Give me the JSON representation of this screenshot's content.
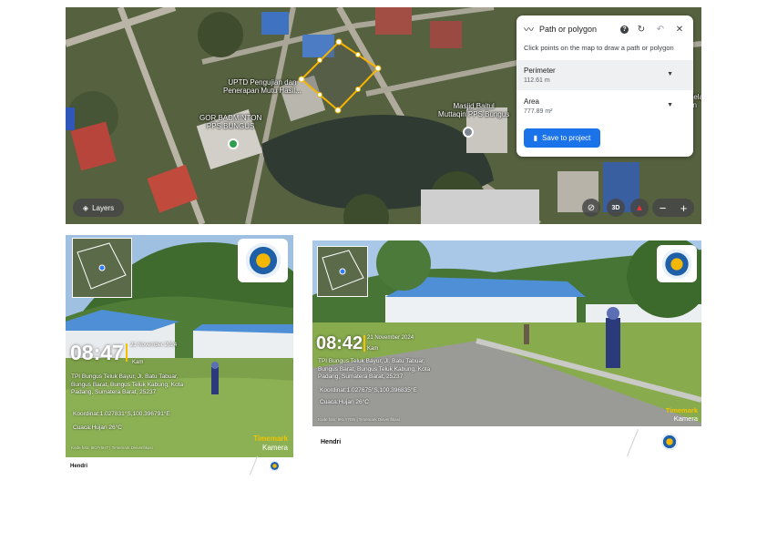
{
  "map": {
    "labels": {
      "uptd": "UPTD Pengujian dan\nPenerapan Mutu Hasil...",
      "gor": "GOR BADMINTON\nPPS BUNGUS",
      "masjid": "Masjid Baitul\nMuttaqin PPS Bungus",
      "edge": "Pelat\nan"
    },
    "layers_label": "Layers",
    "controls": {
      "compass_off_icon": "location-off-icon",
      "three_d_label": "3D",
      "zoom_out": "−",
      "zoom_in": "+"
    },
    "measure_panel": {
      "title": "Path or polygon",
      "hint": "Click points on the map to draw a path or polygon",
      "perimeter_label": "Perimeter",
      "perimeter_value": "112.61 m",
      "area_label": "Area",
      "area_value": "777.89 m²",
      "save_label": "Save to project"
    }
  },
  "photo_left": {
    "time": "08:47",
    "date": "21 November 2024",
    "day": "Kam",
    "address": "TPI Bungus Teluk Bayur, Jl. Batu Tabuar,\nBungus Barat, Bungus Teluk Kabung, Kota\nPadang, Sumatera Barat, 25237",
    "coords": "Koordinat:1.027831°S,100.396791°E",
    "weather": "Cuaca:Hujan 26°C",
    "brand_main": "Timemark",
    "brand_sub": "Kamera",
    "verify": "Kode foto: 6K2Y5H7 | Timemark Disverifikasi",
    "footer_name": "Hendri"
  },
  "photo_right": {
    "time": "08:42",
    "date": "21 November 2024",
    "day": "Kam",
    "address": "TPI Bungus Teluk Bayur, Jl. Batu Tabuar,\nBungus Barat, Bungus Teluk Kabung, Kota\nPadang, Sumatera Barat, 25237",
    "coords": "Koordinat:1.027675°S,100.396835°E",
    "weather": "Cuaca:Hujan 26°C",
    "brand_main": "Timemark",
    "brand_sub": "Kamera",
    "verify": "Kode foto: 9KLY7DB | Timemark Disverifikasi",
    "footer_name": "Hendri"
  },
  "colors": {
    "accent_blue": "#1a73e8",
    "polygon_yellow": "#f4b400",
    "timemark_yellow": "#f2c200"
  }
}
